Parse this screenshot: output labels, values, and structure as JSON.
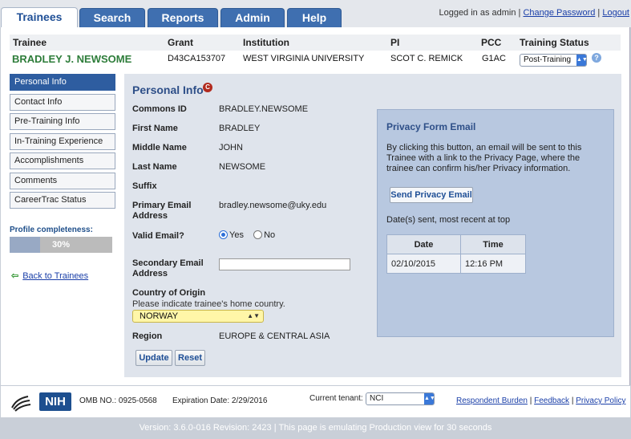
{
  "tabs": [
    {
      "label": "Trainees",
      "active": true
    },
    {
      "label": "Search",
      "active": false
    },
    {
      "label": "Reports",
      "active": false
    },
    {
      "label": "Admin",
      "active": false
    },
    {
      "label": "Help",
      "active": false
    }
  ],
  "user": {
    "logged_in_text": "Logged in as admin",
    "sep1": " | ",
    "change_password": "Change Password",
    "sep2": " | ",
    "logout": "Logout"
  },
  "trainee_header": {
    "labels": {
      "trainee": "Trainee",
      "grant": "Grant",
      "institution": "Institution",
      "pi": "PI",
      "pcc": "PCC",
      "training_status": "Training Status"
    },
    "values": {
      "trainee": "BRADLEY J. NEWSOME",
      "grant": "D43CA153707",
      "institution": "WEST VIRGINIA UNIVERSITY",
      "pi": "SCOT C. REMICK",
      "pcc": "G1AC",
      "training_status": "Post-Training"
    },
    "help_icon": "?"
  },
  "sidebar": {
    "items": [
      {
        "label": "Personal Info",
        "active": true
      },
      {
        "label": "Contact Info",
        "active": false
      },
      {
        "label": "Pre-Training Info",
        "active": false
      },
      {
        "label": "In-Training Experience",
        "active": false
      },
      {
        "label": "Accomplishments",
        "active": false
      },
      {
        "label": "Comments",
        "active": false
      },
      {
        "label": "CareerTrac Status",
        "active": false
      }
    ],
    "profile_completeness_label": "Profile completeness:",
    "profile_completeness_value": "30%",
    "profile_completeness_fraction": 0.3,
    "back_link_arrow": "⇦",
    "back_link": "Back to Trainees"
  },
  "personal_info": {
    "title": "Personal Info",
    "c_icon": "C",
    "fields": {
      "commons_id": {
        "label": "Commons ID",
        "value": "BRADLEY.NEWSOME"
      },
      "first_name": {
        "label": "First Name",
        "value": "BRADLEY"
      },
      "middle_name": {
        "label": "Middle Name",
        "value": "JOHN"
      },
      "last_name": {
        "label": "Last Name",
        "value": "NEWSOME"
      },
      "suffix": {
        "label": "Suffix",
        "value": ""
      },
      "primary_email": {
        "label_line1": "Primary Email",
        "label_line2": "Address",
        "value": "bradley.newsome@uky.edu"
      },
      "valid_email": {
        "label": "Valid Email?",
        "yes_label": "Yes",
        "no_label": "No",
        "selected": "Yes"
      },
      "secondary_email": {
        "label_line1": "Secondary Email",
        "label_line2": "Address",
        "value": ""
      },
      "country_of_origin": {
        "label": "Country of Origin",
        "hint": "Please indicate trainee's home country.",
        "value": "NORWAY"
      },
      "region": {
        "label": "Region",
        "value": "EUROPE & CENTRAL ASIA"
      }
    },
    "buttons": {
      "update": "Update",
      "reset": "Reset"
    }
  },
  "privacy": {
    "title": "Privacy Form Email",
    "description": "By clicking this button, an email will be sent to this Trainee with a link to the Privacy Page, where the trainee can confirm his/her Privacy information.",
    "send_button": "Send Privacy Email",
    "dates_label": "Date(s) sent, most recent at top",
    "table": {
      "headers": [
        "Date",
        "Time"
      ],
      "rows": [
        [
          "02/10/2015",
          "12:16 PM"
        ]
      ]
    }
  },
  "footer": {
    "nih_logo": "NIH",
    "omb": "OMB NO.: 0925-0568",
    "expiration": "Expiration Date: 2/29/2016",
    "tenant_label": "Current tenant:",
    "tenant_value": "NCI",
    "links": {
      "respondent_burden": "Respondent Burden",
      "sep1": " | ",
      "feedback": "Feedback",
      "sep2": " | ",
      "privacy_policy": "Privacy Policy"
    }
  },
  "version_text": "Version: 3.6.0-016 Revision: 2423 | This page is emulating Production view for 30 seconds"
}
